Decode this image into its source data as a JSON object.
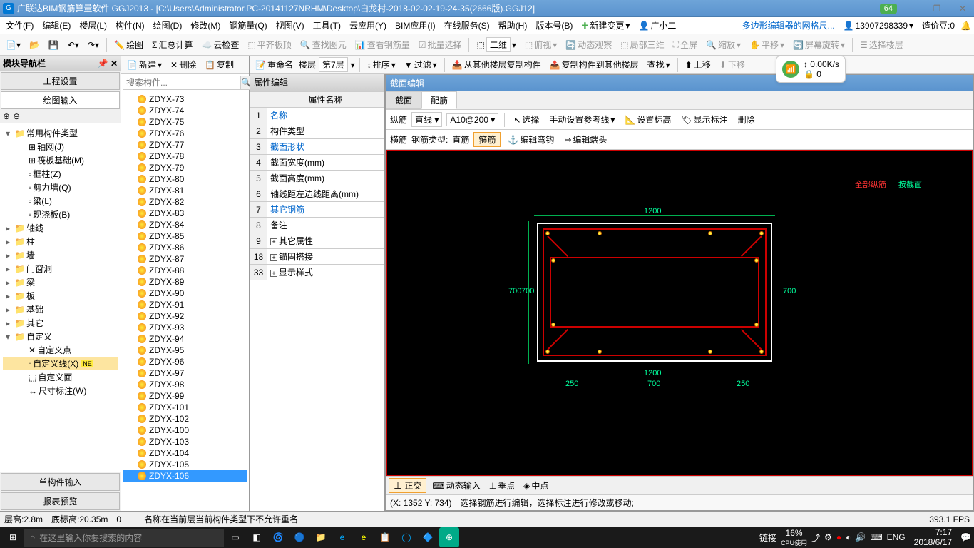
{
  "title": "广联达BIM钢筋算量软件 GGJ2013 - [C:\\Users\\Administrator.PC-20141127NRHM\\Desktop\\白龙村-2018-02-02-19-24-35(2666版).GGJ12]",
  "title_score": "64",
  "menubar": [
    "文件(F)",
    "编辑(E)",
    "楼层(L)",
    "构件(N)",
    "绘图(D)",
    "修改(M)",
    "钢筋量(Q)",
    "视图(V)",
    "工具(T)",
    "云应用(Y)",
    "BIM应用(I)",
    "在线服务(S)",
    "帮助(H)",
    "版本号(B)"
  ],
  "menu_new_change": "新建变更",
  "menu_user": "广小二",
  "menu_link": "多边形编辑器的网格尺...",
  "menu_phone": "13907298339",
  "menu_cost": "造价豆:0",
  "toolbar1": {
    "draw": "绘图",
    "sum": "汇总计算",
    "cloud": "云检查",
    "flat": "平齐板顶",
    "find": "查找图元",
    "view_rebar": "查看钢筋量",
    "batch": "批量选择",
    "view2d": "二维",
    "bird": "俯视",
    "dyn": "动态观察",
    "local3d": "局部三维",
    "full": "全屏",
    "zoom": "缩放",
    "pan": "平移",
    "rotate": "屏幕旋转",
    "sel_floor": "选择楼层"
  },
  "toolbar2": {
    "new": "新建",
    "del": "删除",
    "copy": "复制",
    "rename": "重命名",
    "floor": "楼层",
    "floor_sel": "第7层",
    "sort": "排序",
    "filter": "过滤",
    "copy_from": "从其他楼层复制构件",
    "copy_to": "复制构件到其他楼层",
    "find": "查找",
    "up": "上移",
    "down": "下移"
  },
  "net": {
    "speed": "0.00K/s",
    "lock": "0"
  },
  "nav": {
    "title": "模块导航栏",
    "engineering": "工程设置",
    "drawing": "绘图输入",
    "common": "常用构件类型",
    "items_common": [
      "轴网(J)",
      "筏板基础(M)",
      "框柱(Z)",
      "剪力墙(Q)",
      "梁(L)",
      "现浇板(B)"
    ],
    "cats": [
      "轴线",
      "柱",
      "墙",
      "门窗洞",
      "梁",
      "板",
      "基础",
      "其它"
    ],
    "custom": "自定义",
    "custom_items": [
      "自定义点",
      "自定义线(X)",
      "自定义面",
      "尺寸标注(W)"
    ],
    "single_input": "单构件输入",
    "report": "报表预览"
  },
  "search_placeholder": "搜索构件...",
  "components": [
    "ZDYX-73",
    "ZDYX-74",
    "ZDYX-75",
    "ZDYX-76",
    "ZDYX-77",
    "ZDYX-78",
    "ZDYX-79",
    "ZDYX-80",
    "ZDYX-81",
    "ZDYX-82",
    "ZDYX-83",
    "ZDYX-84",
    "ZDYX-85",
    "ZDYX-86",
    "ZDYX-87",
    "ZDYX-88",
    "ZDYX-89",
    "ZDYX-90",
    "ZDYX-91",
    "ZDYX-92",
    "ZDYX-93",
    "ZDYX-94",
    "ZDYX-95",
    "ZDYX-96",
    "ZDYX-97",
    "ZDYX-98",
    "ZDYX-99",
    "ZDYX-101",
    "ZDYX-102",
    "ZDYX-100",
    "ZDYX-103",
    "ZDYX-104",
    "ZDYX-105",
    "ZDYX-106"
  ],
  "selected_component_index": 33,
  "prop": {
    "title": "属性编辑",
    "header": "属性名称",
    "rows": [
      {
        "n": "1",
        "name": "名称",
        "blue": true
      },
      {
        "n": "2",
        "name": "构件类型"
      },
      {
        "n": "3",
        "name": "截面形状",
        "blue": true
      },
      {
        "n": "4",
        "name": "截面宽度(mm)"
      },
      {
        "n": "5",
        "name": "截面高度(mm)"
      },
      {
        "n": "6",
        "name": "轴线距左边线距离(mm)"
      },
      {
        "n": "7",
        "name": "其它钢筋",
        "blue": true
      },
      {
        "n": "8",
        "name": "备注"
      },
      {
        "n": "9",
        "name": "其它属性",
        "exp": true
      },
      {
        "n": "18",
        "name": "锚固搭接",
        "exp": true
      },
      {
        "n": "33",
        "name": "显示样式",
        "exp": true
      }
    ]
  },
  "canvas": {
    "title": "截面编辑",
    "tabs": [
      "截面",
      "配筋"
    ],
    "active_tab": 1,
    "tb1": {
      "long": "纵筋",
      "line": "直线",
      "spec": "A10@200",
      "sel": "选择",
      "manual": "手动设置参考线",
      "set_h": "设置标高",
      "show_label": "显示标注",
      "del": "删除"
    },
    "tb2": {
      "cross": "横筋",
      "type_lbl": "钢筋类型:",
      "type": "直筋",
      "stirrup": "箍筋",
      "edit_hook": "编辑弯钩",
      "edit_end": "编辑端头"
    },
    "legend": {
      "all": "全部纵筋",
      "by": "按截面"
    },
    "dims": {
      "w": "1200",
      "h": "700",
      "seg1": "250",
      "seg2": "700",
      "seg3": "250"
    },
    "bottom": {
      "ortho": "正交",
      "dyn": "动态输入",
      "perp": "垂点",
      "mid": "中点"
    },
    "coord": "(X: 1352 Y: 734)",
    "hint": "选择钢筋进行编辑，选择标注进行修改或移动;"
  },
  "status": {
    "layer": "层高:2.8m",
    "bottom": "底标高:20.35m",
    "zero": "0",
    "msg": "名称在当前层当前构件类型下不允许重名",
    "fps": "393.1 FPS"
  },
  "taskbar": {
    "search": "在这里输入你要搜索的内容",
    "link": "链接",
    "cpu_pct": "16%",
    "cpu_lbl": "CPU使用",
    "lang": "ENG",
    "time": "7:17",
    "date": "2018/6/17"
  }
}
